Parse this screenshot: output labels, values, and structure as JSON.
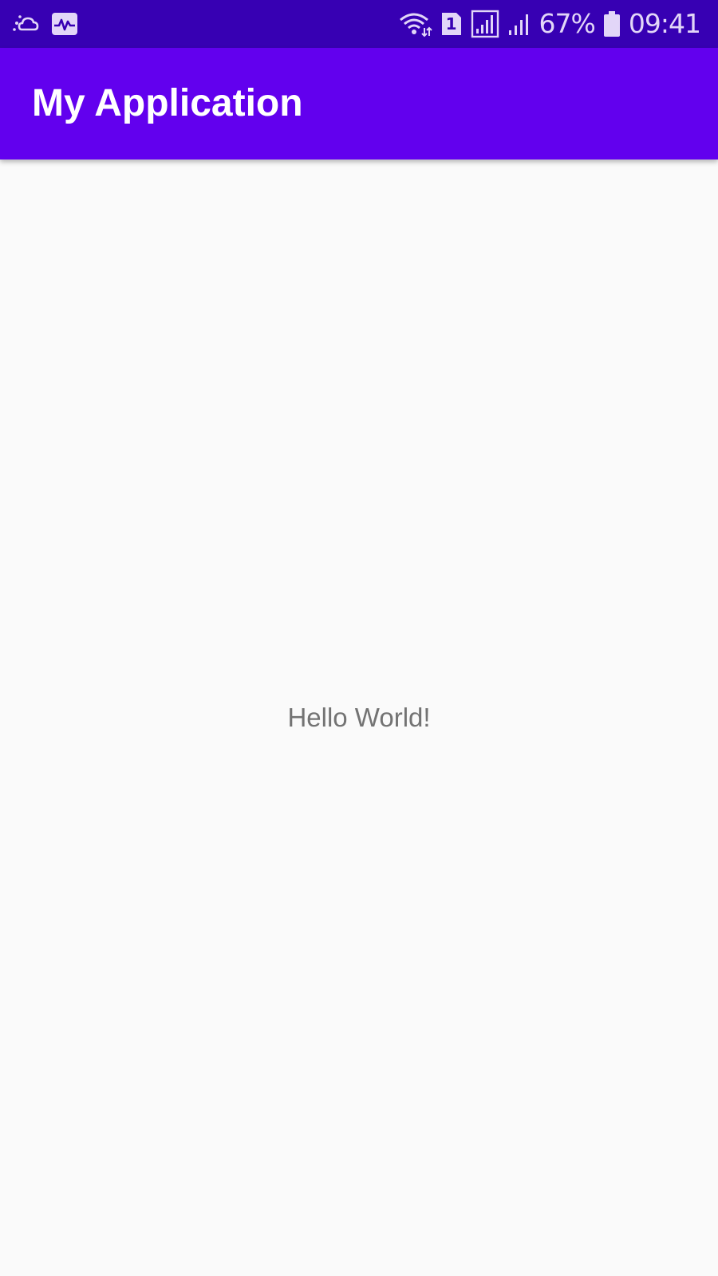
{
  "status_bar": {
    "left_icons": [
      "weather-icon",
      "activity-monitor-icon"
    ],
    "right_icons": [
      "wifi-icon",
      "sim-1-icon",
      "signal-icon",
      "signal-icon-2",
      "battery-icon"
    ],
    "sim_number": "1",
    "battery_percent": "67%",
    "time": "09:41"
  },
  "app_bar": {
    "title": "My Application",
    "color": "#6200ee"
  },
  "main": {
    "message": "Hello World!"
  },
  "colors": {
    "status_bar": "#3700b3",
    "app_bar": "#6200ee",
    "background": "#fafafa",
    "message_text": "#737373"
  }
}
